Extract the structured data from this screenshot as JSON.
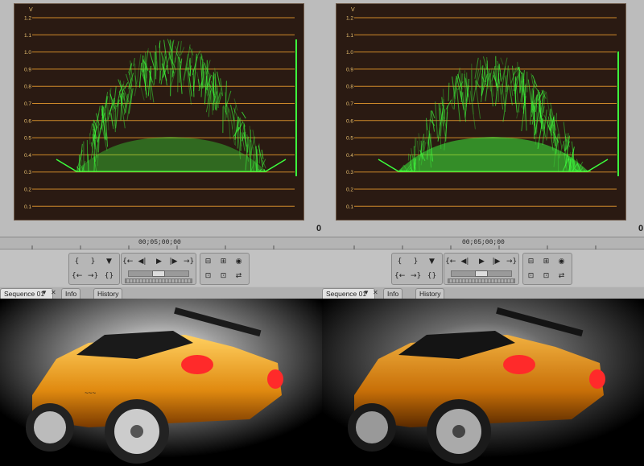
{
  "scopes": [
    {
      "id": "left",
      "unit_label": "V",
      "tick_labels": [
        "1.2",
        "1.1",
        "1.0",
        "0.9",
        "0.8",
        "0.7",
        "0.6",
        "0.5",
        "0.4",
        "0.3",
        "0.2",
        "0.1"
      ],
      "level_readout": "0"
    },
    {
      "id": "right",
      "unit_label": "V",
      "tick_labels": [
        "1.2",
        "1.1",
        "1.0",
        "0.9",
        "0.8",
        "0.7",
        "0.6",
        "0.5",
        "0.4",
        "0.3",
        "0.2",
        "0.1"
      ],
      "level_readout": "0"
    }
  ],
  "monitors": [
    {
      "timecode": "00;05;00;00",
      "tabs": [
        "Sequence 01",
        "Info",
        "History"
      ],
      "active_tab": "Sequence 01"
    },
    {
      "timecode": "00;05;00;00",
      "tabs": [
        "Sequence 01",
        "Info",
        "History"
      ],
      "active_tab": "Sequence 01"
    }
  ],
  "icons": {
    "mark_in": "mark-in-icon",
    "mark_out": "mark-out-icon",
    "marker": "marker-icon",
    "go_in": "go-to-in-icon",
    "go_out": "go-to-out-icon",
    "step_back": "step-back-icon",
    "play": "play-icon",
    "step_forward": "step-forward-icon",
    "shuttle": "shuttle-icon",
    "lift": "lift-icon",
    "extract": "extract-icon",
    "export_frame": "export-frame-icon"
  },
  "colors": {
    "waveform": "#3dff3d",
    "gridline": "#d08a2a",
    "scope_bg": "#2a1a12",
    "tab_accent": "#e0a93a",
    "car_body": "#f0a020",
    "tail_light": "#ff2a2a"
  }
}
